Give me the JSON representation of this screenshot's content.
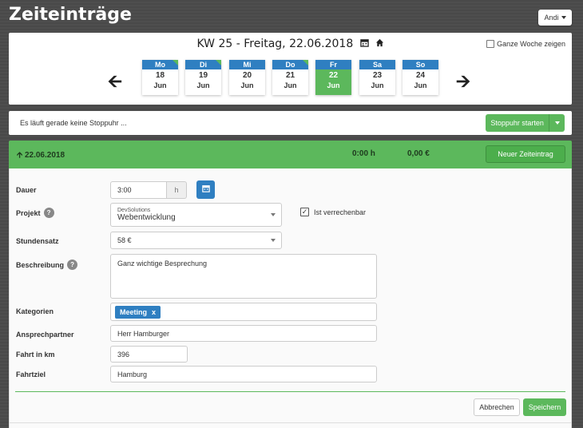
{
  "page": {
    "title": "Zeiteinträge"
  },
  "user_menu": {
    "label": "Andi"
  },
  "week": {
    "title": "KW 25 - Freitag, 22.06.2018",
    "show_whole_week_label": "Ganze Woche zeigen",
    "show_whole_week_checked": false,
    "days": [
      {
        "name": "Mo",
        "num": "18",
        "month": "Jun",
        "active": false,
        "has_entry": true
      },
      {
        "name": "Di",
        "num": "19",
        "month": "Jun",
        "active": false,
        "has_entry": true
      },
      {
        "name": "Mi",
        "num": "20",
        "month": "Jun",
        "active": false,
        "has_entry": false
      },
      {
        "name": "Do",
        "num": "21",
        "month": "Jun",
        "active": false,
        "has_entry": true
      },
      {
        "name": "Fr",
        "num": "22",
        "month": "Jun",
        "active": true,
        "has_entry": false
      },
      {
        "name": "Sa",
        "num": "23",
        "month": "Jun",
        "active": false,
        "has_entry": false
      },
      {
        "name": "So",
        "num": "24",
        "month": "Jun",
        "active": false,
        "has_entry": false
      }
    ]
  },
  "stopwatch": {
    "status_text": "Es läuft gerade keine Stoppuhr ...",
    "start_label": "Stoppuhr starten"
  },
  "entry": {
    "date": "22.06.2018",
    "hours": "0:00 h",
    "amount": "0,00 €",
    "new_entry_label": "Neuer Zeiteintrag"
  },
  "form": {
    "duration_label": "Dauer",
    "duration_value": "3:00",
    "duration_unit": "h",
    "project_label": "Projekt",
    "project_client": "DevSolutions",
    "project_value": "Webentwicklung",
    "billable_label": "Ist verrechenbar",
    "billable_checked": true,
    "rate_label": "Stundensatz",
    "rate_value": "58 €",
    "description_label": "Beschreibung",
    "description_value": "Ganz wichtige Besprechung",
    "categories_label": "Kategorien",
    "category_tag": "Meeting",
    "category_remove": "x",
    "contact_label": "Ansprechpartner",
    "contact_value": "Herr Hamburger",
    "km_label": "Fahrt in km",
    "km_value": "396",
    "destination_label": "Fahrtziel",
    "destination_value": "Hamburg",
    "cancel_label": "Abbrechen",
    "save_label": "Speichern"
  },
  "colors": {
    "accent_green": "#5cb85c",
    "accent_blue": "#2f7fc1"
  },
  "icons": [
    "calendar-icon",
    "home-icon",
    "arrow-left-icon",
    "arrow-right-icon",
    "arrow-up-icon",
    "help-icon",
    "checkbox-icon",
    "chevron-down-icon"
  ]
}
